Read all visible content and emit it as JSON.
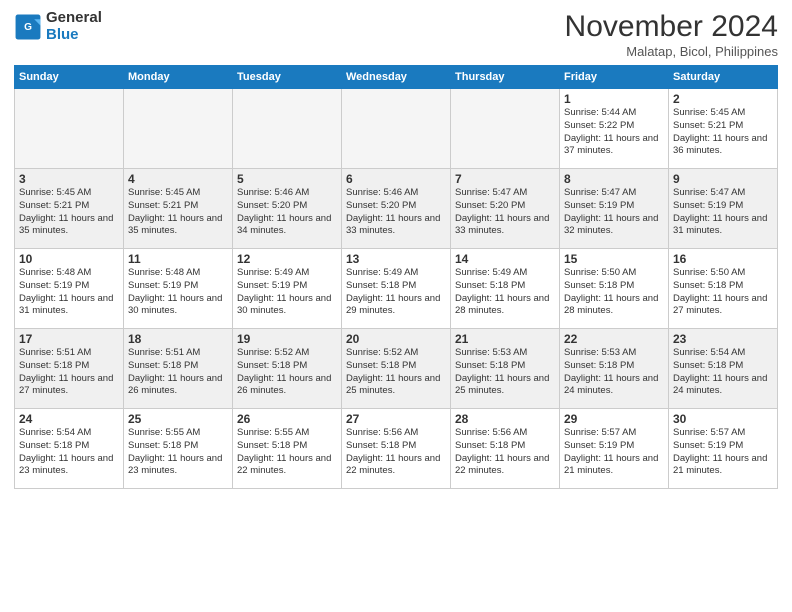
{
  "logo": {
    "line1": "General",
    "line2": "Blue"
  },
  "title": "November 2024",
  "location": "Malatap, Bicol, Philippines",
  "weekdays": [
    "Sunday",
    "Monday",
    "Tuesday",
    "Wednesday",
    "Thursday",
    "Friday",
    "Saturday"
  ],
  "weeks": [
    [
      {
        "day": "",
        "info": ""
      },
      {
        "day": "",
        "info": ""
      },
      {
        "day": "",
        "info": ""
      },
      {
        "day": "",
        "info": ""
      },
      {
        "day": "",
        "info": ""
      },
      {
        "day": "1",
        "info": "Sunrise: 5:44 AM\nSunset: 5:22 PM\nDaylight: 11 hours and 37 minutes."
      },
      {
        "day": "2",
        "info": "Sunrise: 5:45 AM\nSunset: 5:21 PM\nDaylight: 11 hours and 36 minutes."
      }
    ],
    [
      {
        "day": "3",
        "info": "Sunrise: 5:45 AM\nSunset: 5:21 PM\nDaylight: 11 hours and 35 minutes."
      },
      {
        "day": "4",
        "info": "Sunrise: 5:45 AM\nSunset: 5:21 PM\nDaylight: 11 hours and 35 minutes."
      },
      {
        "day": "5",
        "info": "Sunrise: 5:46 AM\nSunset: 5:20 PM\nDaylight: 11 hours and 34 minutes."
      },
      {
        "day": "6",
        "info": "Sunrise: 5:46 AM\nSunset: 5:20 PM\nDaylight: 11 hours and 33 minutes."
      },
      {
        "day": "7",
        "info": "Sunrise: 5:47 AM\nSunset: 5:20 PM\nDaylight: 11 hours and 33 minutes."
      },
      {
        "day": "8",
        "info": "Sunrise: 5:47 AM\nSunset: 5:19 PM\nDaylight: 11 hours and 32 minutes."
      },
      {
        "day": "9",
        "info": "Sunrise: 5:47 AM\nSunset: 5:19 PM\nDaylight: 11 hours and 31 minutes."
      }
    ],
    [
      {
        "day": "10",
        "info": "Sunrise: 5:48 AM\nSunset: 5:19 PM\nDaylight: 11 hours and 31 minutes."
      },
      {
        "day": "11",
        "info": "Sunrise: 5:48 AM\nSunset: 5:19 PM\nDaylight: 11 hours and 30 minutes."
      },
      {
        "day": "12",
        "info": "Sunrise: 5:49 AM\nSunset: 5:19 PM\nDaylight: 11 hours and 30 minutes."
      },
      {
        "day": "13",
        "info": "Sunrise: 5:49 AM\nSunset: 5:18 PM\nDaylight: 11 hours and 29 minutes."
      },
      {
        "day": "14",
        "info": "Sunrise: 5:49 AM\nSunset: 5:18 PM\nDaylight: 11 hours and 28 minutes."
      },
      {
        "day": "15",
        "info": "Sunrise: 5:50 AM\nSunset: 5:18 PM\nDaylight: 11 hours and 28 minutes."
      },
      {
        "day": "16",
        "info": "Sunrise: 5:50 AM\nSunset: 5:18 PM\nDaylight: 11 hours and 27 minutes."
      }
    ],
    [
      {
        "day": "17",
        "info": "Sunrise: 5:51 AM\nSunset: 5:18 PM\nDaylight: 11 hours and 27 minutes."
      },
      {
        "day": "18",
        "info": "Sunrise: 5:51 AM\nSunset: 5:18 PM\nDaylight: 11 hours and 26 minutes."
      },
      {
        "day": "19",
        "info": "Sunrise: 5:52 AM\nSunset: 5:18 PM\nDaylight: 11 hours and 26 minutes."
      },
      {
        "day": "20",
        "info": "Sunrise: 5:52 AM\nSunset: 5:18 PM\nDaylight: 11 hours and 25 minutes."
      },
      {
        "day": "21",
        "info": "Sunrise: 5:53 AM\nSunset: 5:18 PM\nDaylight: 11 hours and 25 minutes."
      },
      {
        "day": "22",
        "info": "Sunrise: 5:53 AM\nSunset: 5:18 PM\nDaylight: 11 hours and 24 minutes."
      },
      {
        "day": "23",
        "info": "Sunrise: 5:54 AM\nSunset: 5:18 PM\nDaylight: 11 hours and 24 minutes."
      }
    ],
    [
      {
        "day": "24",
        "info": "Sunrise: 5:54 AM\nSunset: 5:18 PM\nDaylight: 11 hours and 23 minutes."
      },
      {
        "day": "25",
        "info": "Sunrise: 5:55 AM\nSunset: 5:18 PM\nDaylight: 11 hours and 23 minutes."
      },
      {
        "day": "26",
        "info": "Sunrise: 5:55 AM\nSunset: 5:18 PM\nDaylight: 11 hours and 22 minutes."
      },
      {
        "day": "27",
        "info": "Sunrise: 5:56 AM\nSunset: 5:18 PM\nDaylight: 11 hours and 22 minutes."
      },
      {
        "day": "28",
        "info": "Sunrise: 5:56 AM\nSunset: 5:18 PM\nDaylight: 11 hours and 22 minutes."
      },
      {
        "day": "29",
        "info": "Sunrise: 5:57 AM\nSunset: 5:19 PM\nDaylight: 11 hours and 21 minutes."
      },
      {
        "day": "30",
        "info": "Sunrise: 5:57 AM\nSunset: 5:19 PM\nDaylight: 11 hours and 21 minutes."
      }
    ]
  ]
}
